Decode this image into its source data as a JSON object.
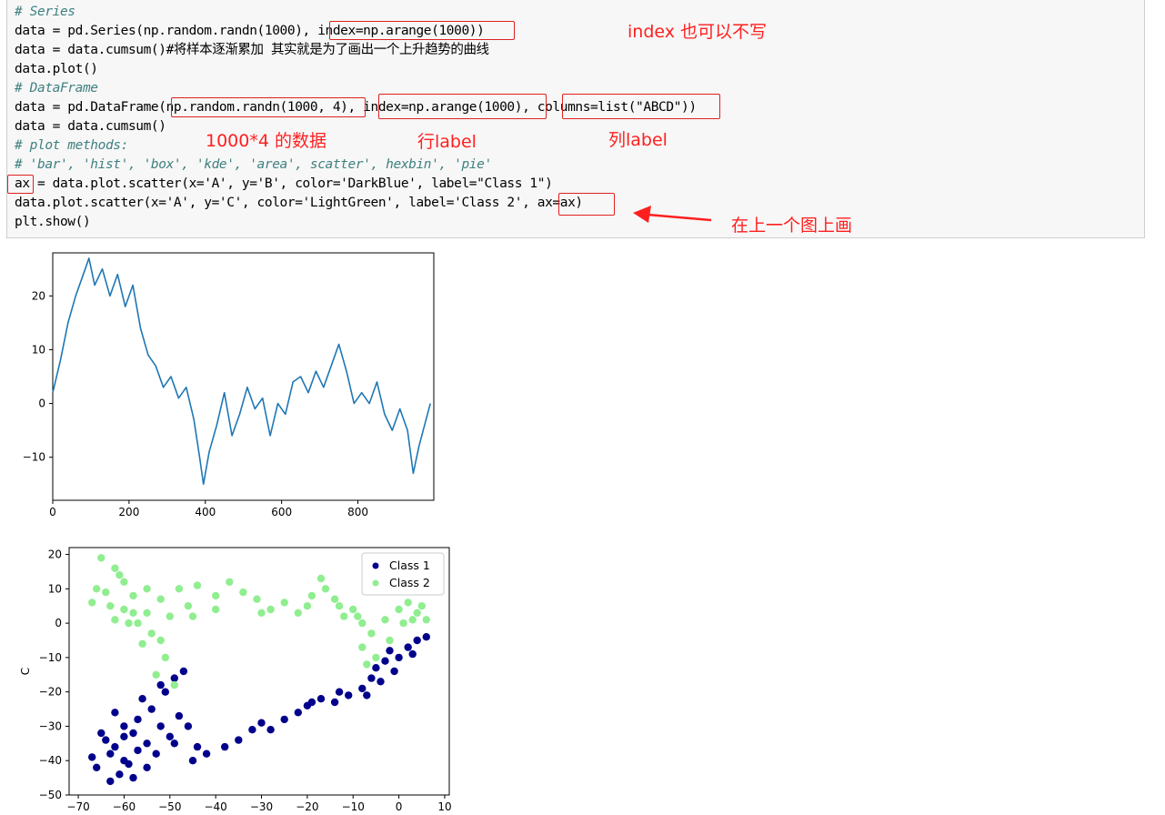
{
  "code_cell": {
    "lines": [
      "# Series",
      "data = pd.Series(np.random.randn(1000), index=np.arange(1000))",
      "data = data.cumsum()#将样本逐渐累加 其实就是为了画出一个上升趋势的曲线",
      "data.plot()",
      "# DataFrame",
      "data = pd.DataFrame(np.random.randn(1000, 4), index=np.arange(1000), columns=list(\"ABCD\"))",
      "data = data.cumsum()",
      "# plot methods:",
      "# 'bar', 'hist', 'box', 'kde', 'area', scatter', hexbin', 'pie'",
      "ax = data.plot.scatter(x='A', y='B', color='DarkBlue', label=\"Class 1\")",
      "data.plot.scatter(x='A', y='C', color='LightGreen', label='Class 2', ax=ax)",
      "plt.show()"
    ]
  },
  "annotations": {
    "index_note": "index 也可以不写",
    "data_note": "1000*4 的数据",
    "row_note": "行label",
    "col_note": "列label",
    "same_axes_note": "在上一个图上画"
  },
  "colors": {
    "annotation_red": "#ff1f1f",
    "line_blue": "#1f77b4",
    "class1": "#00008b",
    "class2": "#90ee90"
  },
  "chart_data": [
    {
      "type": "line",
      "title": "",
      "xlabel": "",
      "ylabel": "",
      "xlim": [
        0,
        999
      ],
      "ylim": [
        -18,
        28
      ],
      "xticks": [
        0,
        200,
        400,
        600,
        800
      ],
      "yticks": [
        20,
        10,
        0,
        -10
      ],
      "series": [
        {
          "x": [
            0,
            20,
            40,
            60,
            80,
            95,
            110,
            130,
            150,
            170,
            190,
            210,
            230,
            250,
            270,
            290,
            310,
            330,
            350,
            370,
            385,
            395,
            410,
            430,
            450,
            470,
            490,
            510,
            530,
            550,
            570,
            590,
            610,
            630,
            650,
            670,
            690,
            710,
            730,
            750,
            770,
            790,
            810,
            830,
            850,
            870,
            890,
            910,
            930,
            945,
            960,
            975,
            990
          ],
          "y": [
            2,
            8,
            15,
            20,
            24,
            27,
            22,
            25,
            20,
            24,
            18,
            22,
            14,
            9,
            7,
            3,
            5,
            1,
            3,
            -3,
            -10,
            -15,
            -9,
            -4,
            2,
            -6,
            -2,
            3,
            -1,
            1,
            -6,
            0,
            -2,
            4,
            5,
            2,
            6,
            3,
            7,
            11,
            6,
            0,
            2,
            0,
            4,
            -2,
            -5,
            -1,
            -5,
            -13,
            -8,
            -4,
            0
          ]
        }
      ]
    },
    {
      "type": "scatter",
      "title": "",
      "xlabel": "",
      "ylabel": "C",
      "xlim": [
        -72,
        11
      ],
      "ylim": [
        -50,
        22
      ],
      "xticks": [
        -70,
        -60,
        -50,
        -40,
        -30,
        -20,
        -10,
        0,
        10
      ],
      "yticks": [
        20,
        10,
        0,
        -10,
        -20,
        -30,
        -40,
        -50
      ],
      "legend": "top-right",
      "series": [
        {
          "name": "Class 1",
          "color": "#00008b",
          "points": [
            [
              -65,
              -32
            ],
            [
              -62,
              -36
            ],
            [
              -60,
              -40
            ],
            [
              -66,
              -42
            ],
            [
              -58,
              -45
            ],
            [
              -63,
              -38
            ],
            [
              -55,
              -35
            ],
            [
              -52,
              -30
            ],
            [
              -57,
              -28
            ],
            [
              -50,
              -33
            ],
            [
              -54,
              -25
            ],
            [
              -56,
              -22
            ],
            [
              -51,
              -20
            ],
            [
              -48,
              -27
            ],
            [
              -60,
              -30
            ],
            [
              -64,
              -34
            ],
            [
              -67,
              -39
            ],
            [
              -61,
              -44
            ],
            [
              -59,
              -41
            ],
            [
              -53,
              -38
            ],
            [
              -49,
              -35
            ],
            [
              -45,
              -40
            ],
            [
              -42,
              -38
            ],
            [
              -38,
              -36
            ],
            [
              -35,
              -34
            ],
            [
              -32,
              -31
            ],
            [
              -28,
              -31
            ],
            [
              -25,
              -28
            ],
            [
              -22,
              -26
            ],
            [
              -20,
              -24
            ],
            [
              -17,
              -22
            ],
            [
              -14,
              -23
            ],
            [
              -11,
              -21
            ],
            [
              -8,
              -19
            ],
            [
              -6,
              -16
            ],
            [
              -5,
              -13
            ],
            [
              -3,
              -11
            ],
            [
              0,
              -10
            ],
            [
              2,
              -7
            ],
            [
              4,
              -5
            ],
            [
              6,
              -4
            ],
            [
              -1,
              -14
            ],
            [
              -4,
              -17
            ],
            [
              -7,
              -21
            ],
            [
              -52,
              -18
            ],
            [
              -49,
              -16
            ],
            [
              -47,
              -14
            ],
            [
              -62,
              -26
            ],
            [
              -58,
              -32
            ],
            [
              -55,
              -42
            ],
            [
              -63,
              -46
            ],
            [
              -57,
              -37
            ],
            [
              -60,
              -33
            ],
            [
              -46,
              -30
            ],
            [
              -44,
              -36
            ],
            [
              -30,
              -29
            ],
            [
              -19,
              -23
            ],
            [
              -13,
              -20
            ],
            [
              -2,
              -8
            ],
            [
              3,
              -9
            ]
          ]
        },
        {
          "name": "Class 2",
          "color": "#90ee90",
          "points": [
            [
              -65,
              19
            ],
            [
              -62,
              16
            ],
            [
              -60,
              12
            ],
            [
              -66,
              10
            ],
            [
              -58,
              8
            ],
            [
              -63,
              5
            ],
            [
              -55,
              3
            ],
            [
              -52,
              7
            ],
            [
              -57,
              0
            ],
            [
              -50,
              2
            ],
            [
              -54,
              -3
            ],
            [
              -56,
              -6
            ],
            [
              -51,
              -10
            ],
            [
              -53,
              -15
            ],
            [
              -49,
              -18
            ],
            [
              -60,
              4
            ],
            [
              -64,
              9
            ],
            [
              -67,
              6
            ],
            [
              -61,
              14
            ],
            [
              -59,
              0
            ],
            [
              -48,
              10
            ],
            [
              -46,
              5
            ],
            [
              -44,
              11
            ],
            [
              -40,
              8
            ],
            [
              -37,
              12
            ],
            [
              -34,
              9
            ],
            [
              -31,
              7
            ],
            [
              -28,
              4
            ],
            [
              -25,
              6
            ],
            [
              -22,
              3
            ],
            [
              -19,
              8
            ],
            [
              -16,
              10
            ],
            [
              -17,
              13
            ],
            [
              -14,
              7
            ],
            [
              -12,
              2
            ],
            [
              -10,
              4
            ],
            [
              -8,
              0
            ],
            [
              -6,
              -3
            ],
            [
              -8,
              -7
            ],
            [
              -5,
              -10
            ],
            [
              -3,
              1
            ],
            [
              0,
              4
            ],
            [
              2,
              6
            ],
            [
              4,
              3
            ],
            [
              6,
              1
            ],
            [
              -7,
              -12
            ],
            [
              -2,
              -5
            ],
            [
              1,
              0
            ],
            [
              -20,
              5
            ],
            [
              -45,
              2
            ],
            [
              -52,
              -5
            ],
            [
              -58,
              3
            ],
            [
              -62,
              1
            ],
            [
              -55,
              10
            ],
            [
              -40,
              4
            ],
            [
              -30,
              3
            ],
            [
              -13,
              5
            ],
            [
              -9,
              2
            ],
            [
              3,
              1
            ],
            [
              5,
              5
            ]
          ]
        }
      ]
    }
  ]
}
